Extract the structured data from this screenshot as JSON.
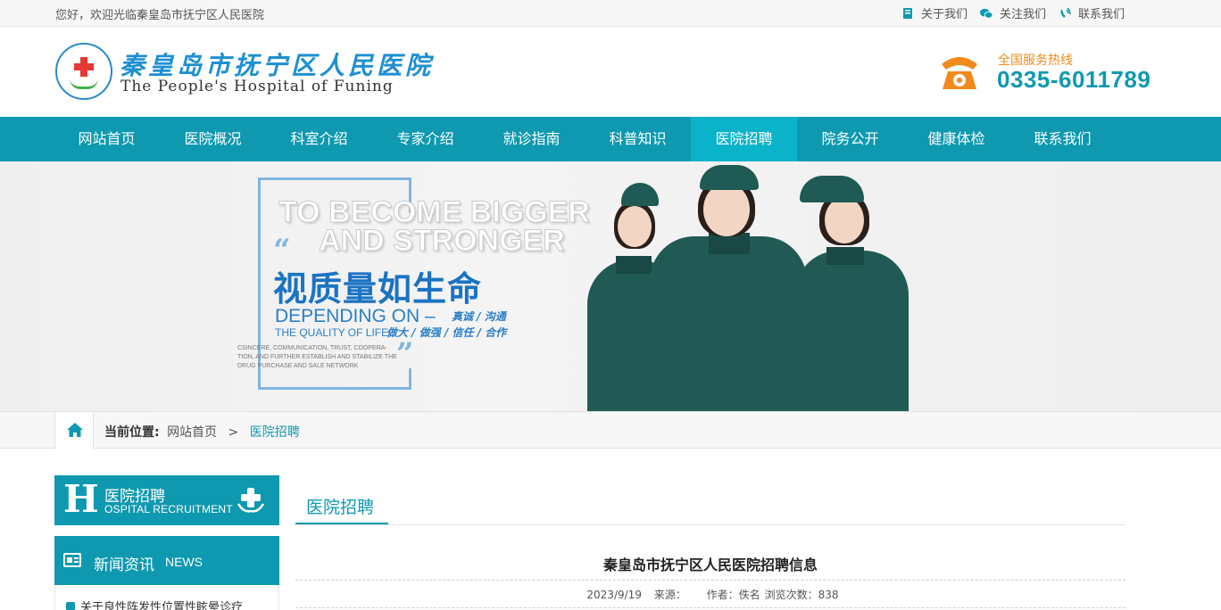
{
  "topbar": {
    "welcome": "您好，欢迎光临秦皇岛市抚宁区人民医院",
    "links": [
      {
        "label": "关于我们",
        "icon": "book-icon"
      },
      {
        "label": "关注我们",
        "icon": "wechat-icon"
      },
      {
        "label": "联系我们",
        "icon": "phone-ring-icon"
      }
    ]
  },
  "header": {
    "logo_cn": "秦皇岛市抚宁区人民医院",
    "logo_en": "The People's Hospital of Funing",
    "hotline_label": "全国服务热线",
    "hotline_number": "0335-6011789"
  },
  "nav": {
    "items": [
      "网站首页",
      "医院概况",
      "科室介绍",
      "专家介绍",
      "就诊指南",
      "科普知识",
      "医院招聘",
      "院务公开",
      "健康体检",
      "联系我们"
    ],
    "active_index": 6
  },
  "banner": {
    "en_line1": "TO BECOME BIGGER",
    "en_line2": "AND STRONGER",
    "slogan_cn": "视质量如生命",
    "depending": "DEPENDING ON –",
    "depending_cn": "真诚 / 沟通",
    "quality": "THE QUALITY OF LIFE",
    "quality_cn": "做大 / 做强 / 信任 / 合作",
    "small_text": "CSINCERE, COMMUNICATION, TRUST, COOPERA- TION, AND FURTHER ESTABLISH AND STABILIZE THE DRUG PURCHASE AND SALE NETWORK"
  },
  "breadcrumb": {
    "label": "当前位置:",
    "home": "网站首页",
    "separator": ">",
    "current": "医院招聘"
  },
  "sidebar": {
    "section_letter": "H",
    "section_cn": "医院招聘",
    "section_en": "OSPITAL RECRUITMENT",
    "news_cn": "新闻资讯",
    "news_en": "NEWS",
    "news_items": [
      "关于良性阵发性位置性眩晕诊疗"
    ]
  },
  "main": {
    "tab": "医院招聘",
    "article_title": "秦皇岛市抚宁区人民医院招聘信息",
    "meta": {
      "date": "2023/9/19",
      "source_label": "来源：",
      "author": "作者：佚名",
      "views_label": "浏览次数：",
      "views": "838"
    }
  },
  "colors": {
    "primary": "#0e99b0",
    "nav_active": "#0ab3c9",
    "hotline_label": "#f08a1c",
    "logo_blue": "#1d8fd1",
    "banner_blue": "#1b73c3"
  }
}
